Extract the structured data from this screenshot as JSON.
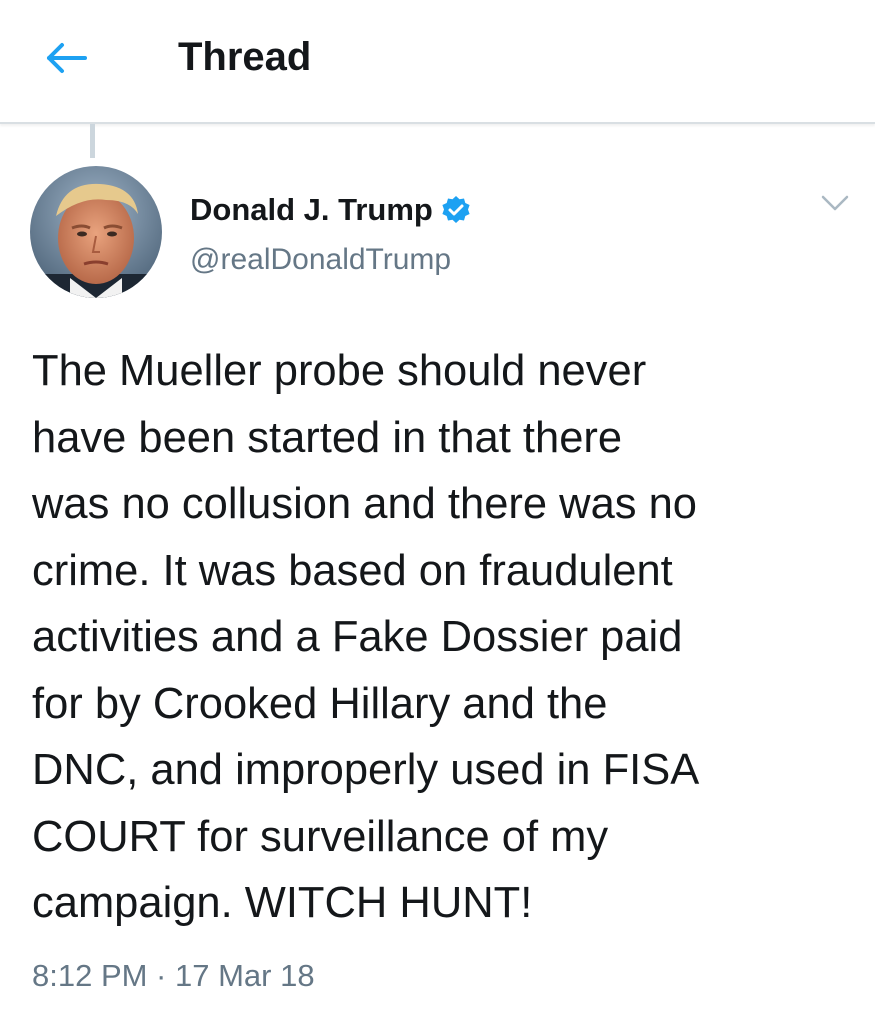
{
  "header": {
    "back_icon": "arrow-left-icon",
    "title": "Thread",
    "accent_color": "#1da1f2"
  },
  "tweet": {
    "author": {
      "display_name": "Donald J. Trump",
      "handle": "@realDonaldTrump",
      "verified": true,
      "verified_icon": "verified-badge-icon",
      "avatar": "profile-photo"
    },
    "menu_icon": "chevron-down-icon",
    "text": "The Mueller probe should never\nhave been started in that there\nwas no collusion and there was no\ncrime. It was based on fraudulent\nactivities and a Fake Dossier paid\nfor by Crooked Hillary and the\nDNC, and improperly used in FISA\nCOURT for surveillance of my\ncampaign. WITCH HUNT!",
    "timestamp": "8:12 PM · 17 Mar 18"
  }
}
